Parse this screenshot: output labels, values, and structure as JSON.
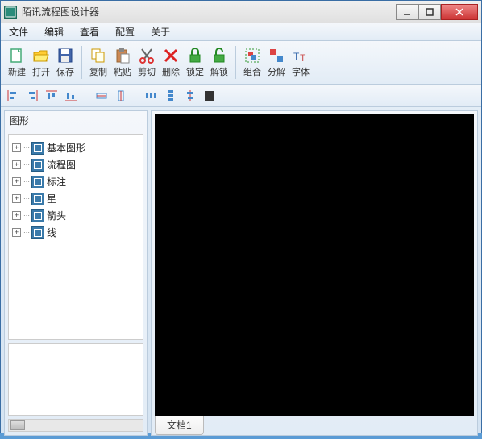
{
  "window": {
    "title": "陌讯流程图设计器"
  },
  "menu": {
    "file": "文件",
    "edit": "编辑",
    "view": "查看",
    "config": "配置",
    "about": "关于"
  },
  "toolbar": {
    "new": "新建",
    "open": "打开",
    "save": "保存",
    "copy": "复制",
    "paste": "粘贴",
    "cut": "剪切",
    "delete": "删除",
    "lock": "锁定",
    "unlock": "解锁",
    "group": "组合",
    "ungroup": "分解",
    "font": "字体"
  },
  "sidebar": {
    "title": "图形",
    "items": [
      {
        "label": "基本图形"
      },
      {
        "label": "流程图"
      },
      {
        "label": "标注"
      },
      {
        "label": "星"
      },
      {
        "label": "箭头"
      },
      {
        "label": "线"
      }
    ]
  },
  "docs": {
    "tab1": "文档1"
  }
}
